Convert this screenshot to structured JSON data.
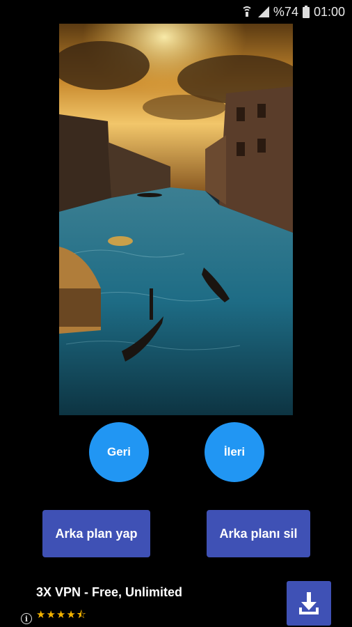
{
  "status_bar": {
    "battery_text": "%74",
    "time": "01:00"
  },
  "wallpaper": {
    "icon": "venice-canal-image"
  },
  "nav": {
    "back_label": "Geri",
    "next_label": "İleri"
  },
  "actions": {
    "set_label": "Arka plan yap",
    "remove_label": "Arka planı sil"
  },
  "ad": {
    "title": "3X VPN - Free, Unlimited",
    "rating_stars": "★★★★⯪",
    "rating": 4.5,
    "info_glyph": "i",
    "download_icon": "download-icon"
  },
  "colors": {
    "circle_button": "#2196f3",
    "rect_button": "#3f51b5",
    "background": "#000000"
  }
}
